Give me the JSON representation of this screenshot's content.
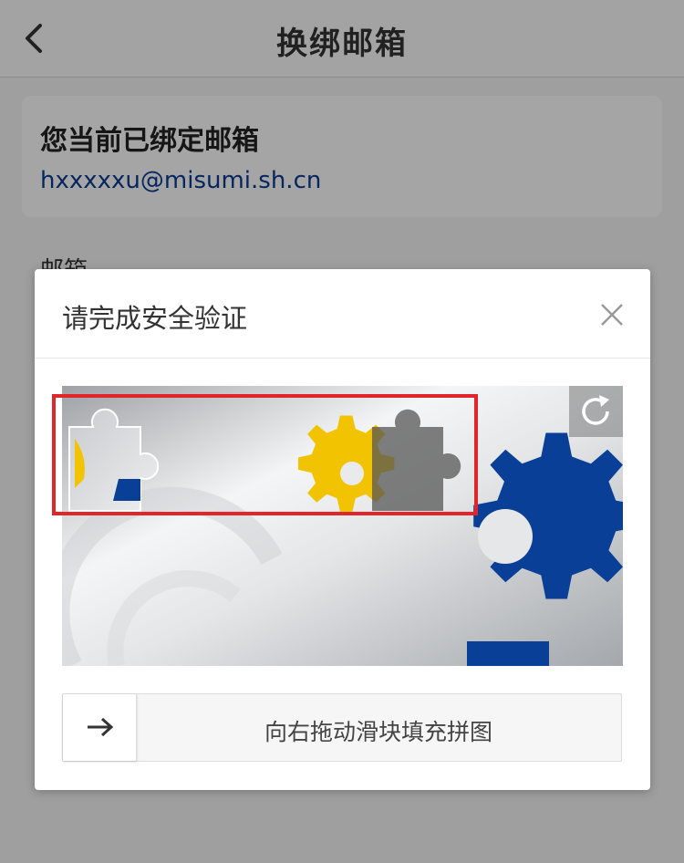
{
  "nav": {
    "title": "换绑邮箱",
    "back_icon": "chevron-left-icon"
  },
  "bound": {
    "title": "您当前已绑定邮箱",
    "email": "hxxxxxu@misumi.sh.cn"
  },
  "form": {
    "email_label": "邮箱"
  },
  "dialog": {
    "title": "请完成安全验证",
    "close_icon": "close-icon",
    "refresh_icon": "refresh-icon",
    "slider_text": "向右拖动滑块填充拼图",
    "slider_icon": "arrow-right-icon"
  },
  "colors": {
    "brand_blue": "#0b3a8f",
    "gear_yellow": "#f2c300",
    "highlight_red": "#e0262a"
  }
}
